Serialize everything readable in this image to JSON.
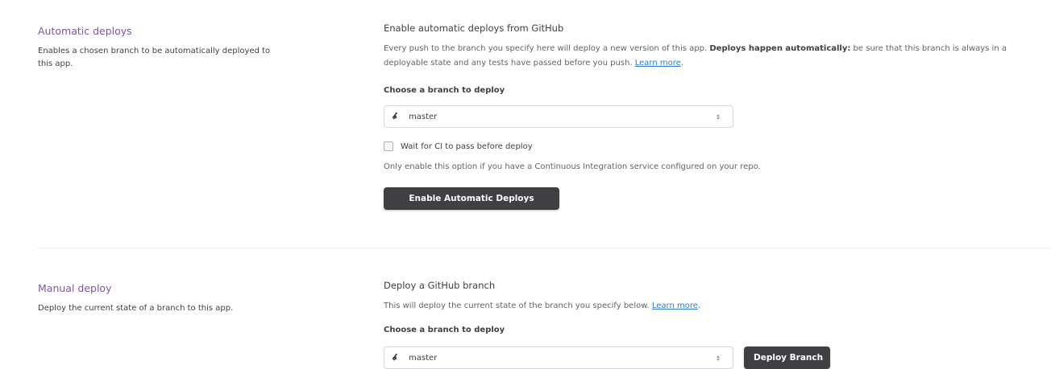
{
  "automatic": {
    "title": "Automatic deploys",
    "description": "Enables a chosen branch to be automatically deployed to this app.",
    "card_title": "Enable automatic deploys from GitHub",
    "text_prefix": "Every push to the branch you specify here will deploy a new version of this app. ",
    "text_bold": "Deploys happen automatically:",
    "text_suffix": " be sure that this branch is always in a deployable state and any tests have passed before you push. ",
    "learn_more": "Learn more",
    "text_end": ".",
    "branch_label": "Choose a branch to deploy",
    "branch_icon": "branch-icon",
    "branch_value": "master",
    "ci_checkbox_label": "Wait for CI to pass before deploy",
    "ci_checked": false,
    "ci_help": "Only enable this option if you have a Continuous Integration service configured on your repo.",
    "button_label": "Enable Automatic Deploys"
  },
  "manual": {
    "title": "Manual deploy",
    "description": "Deploy the current state of a branch to this app.",
    "card_title": "Deploy a GitHub branch",
    "text_prefix": "This will deploy the current state of the branch you specify below. ",
    "learn_more": "Learn more",
    "text_end": ".",
    "branch_label": "Choose a branch to deploy",
    "branch_icon": "branch-icon",
    "branch_value": "master",
    "button_label": "Deploy Branch"
  },
  "colors": {
    "accent_purple": "#79589f",
    "button_dark": "#3f3f44",
    "link_blue": "#2e7bcf"
  }
}
